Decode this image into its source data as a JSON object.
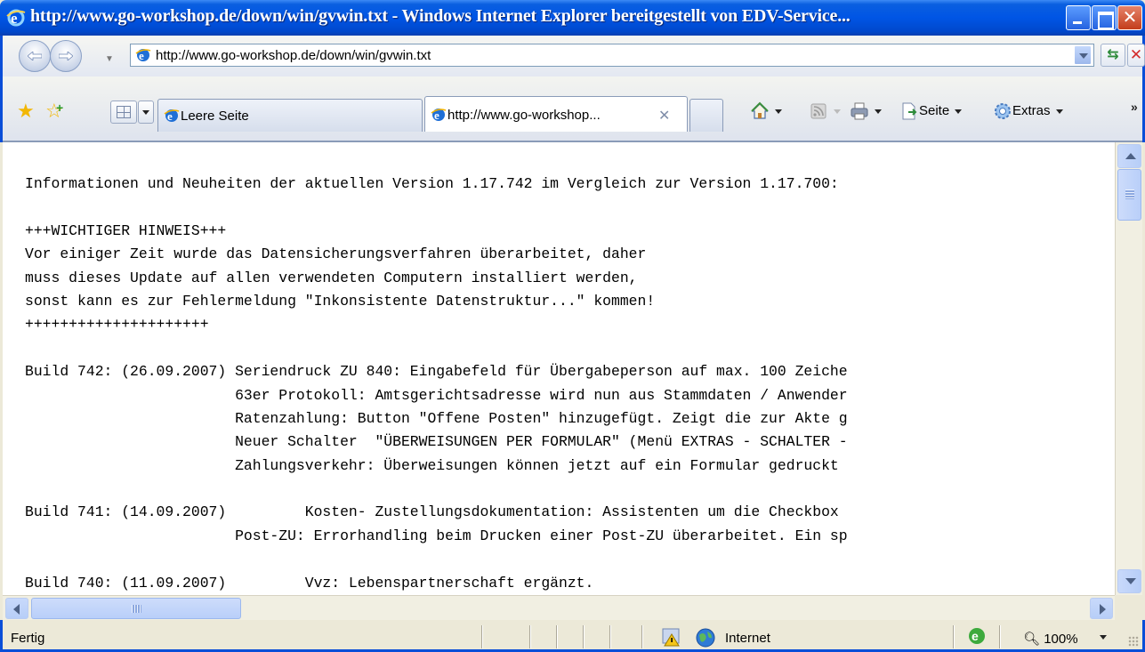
{
  "window": {
    "title": "http://www.go-workshop.de/down/win/gvwin.txt - Windows Internet Explorer bereitgestellt von EDV-Service...",
    "minimize_icon": "minimize-icon",
    "maximize_icon": "maximize-icon",
    "close_icon": "close-icon"
  },
  "addressbar": {
    "url": "http://www.go-workshop.de/down/win/gvwin.txt"
  },
  "tabs": [
    {
      "label": "Leere Seite",
      "active": false
    },
    {
      "label": "http://www.go-workshop...",
      "active": true,
      "close": "✕"
    },
    {
      "label": "",
      "active": false
    }
  ],
  "commandbar": {
    "seite": "Seite",
    "extras": "Extras"
  },
  "document": {
    "lines": [
      "Informationen und Neuheiten der aktuellen Version 1.17.742 im Vergleich zur Version 1.17.700:",
      "",
      "+++WICHTIGER HINWEIS+++",
      "Vor einiger Zeit wurde das Datensicherungsverfahren überarbeitet, daher",
      "muss dieses Update auf allen verwendeten Computern installiert werden,",
      "sonst kann es zur Fehlermeldung \"Inkonsistente Datenstruktur...\" kommen!",
      "+++++++++++++++++++++",
      "",
      "Build 742: (26.09.2007) Seriendruck ZU 840: Eingabefeld für Übergabeperson auf max. 100 Zeiche",
      "                        63er Protokoll: Amtsgerichtsadresse wird nun aus Stammdaten / Anwender",
      "                        Ratenzahlung: Button \"Offene Posten\" hinzugefügt. Zeigt die zur Akte g",
      "                        Neuer Schalter  \"ÜBERWEISUNGEN PER FORMULAR\" (Menü EXTRAS - SCHALTER -",
      "                        Zahlungsverkehr: Überweisungen können jetzt auf ein Formular gedruckt",
      "",
      "Build 741: (14.09.2007)         Kosten- Zustellungsdokumentation: Assistenten um die Checkbox",
      "                        Post-ZU: Errorhandling beim Drucken einer Post-ZU überarbeitet. Ein sp",
      "",
      "Build 740: (11.09.2007)         Vvz: Lebenspartnerschaft ergänzt."
    ]
  },
  "statusbar": {
    "status": "Fertig",
    "zone": "Internet",
    "zoom": "100%"
  },
  "colors": {
    "titlebar": "#0055E5",
    "chrome": "#ECE9D8",
    "close_button": "#C33D1B"
  }
}
